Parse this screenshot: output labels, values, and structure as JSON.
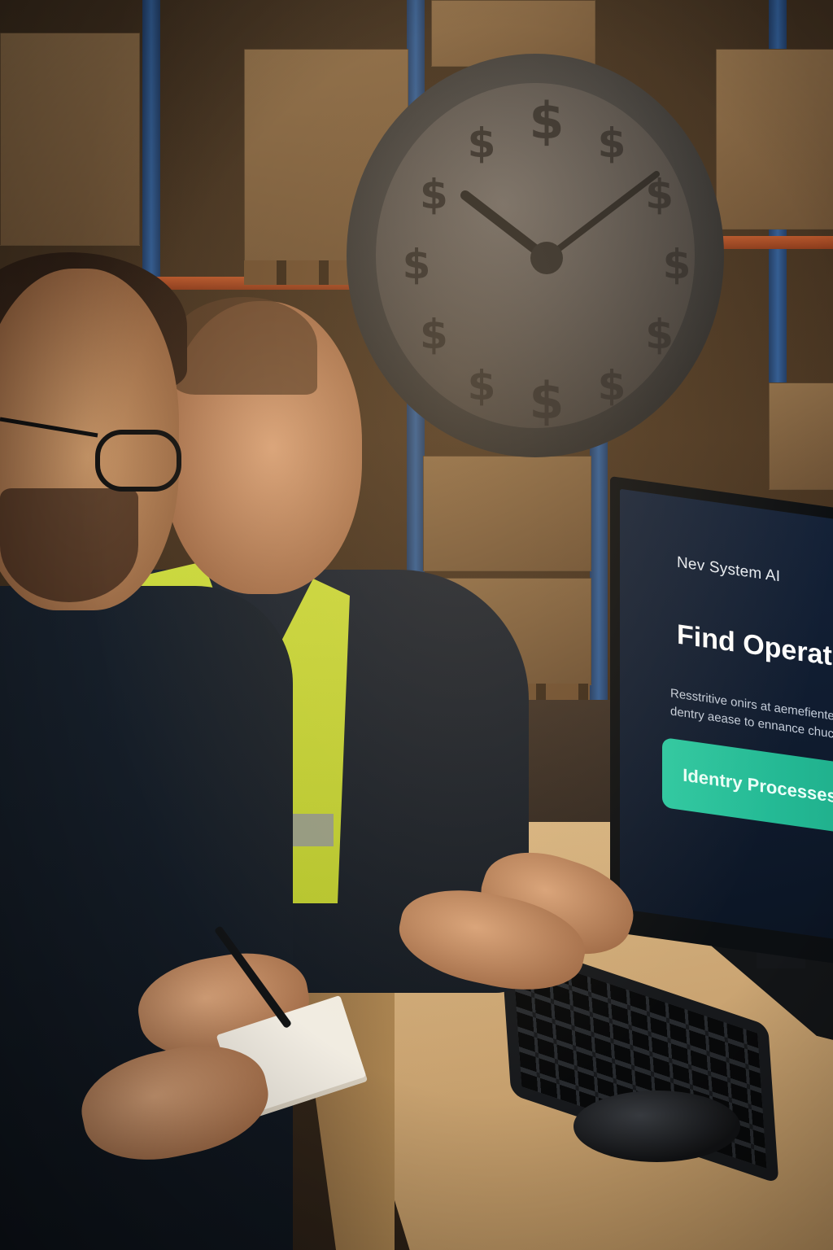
{
  "screen": {
    "brand": "Nev System AI",
    "headline": "Find Operational N",
    "subtext_line1": "Resstritive onirs at aemefientes terals",
    "subtext_line2": "dentry aease to ennance chucency and",
    "cta_label": "Identry Processes"
  },
  "clock": {
    "face_symbol": "$",
    "hour_marker_count": 12
  },
  "colors": {
    "cta": "#26c29c",
    "screen_bg": "#0f1b2e",
    "vest": "#c9d93d",
    "rack_posts": "#2f5b93",
    "rack_beams": "#b3542a",
    "clock": "#4a4a4a"
  }
}
